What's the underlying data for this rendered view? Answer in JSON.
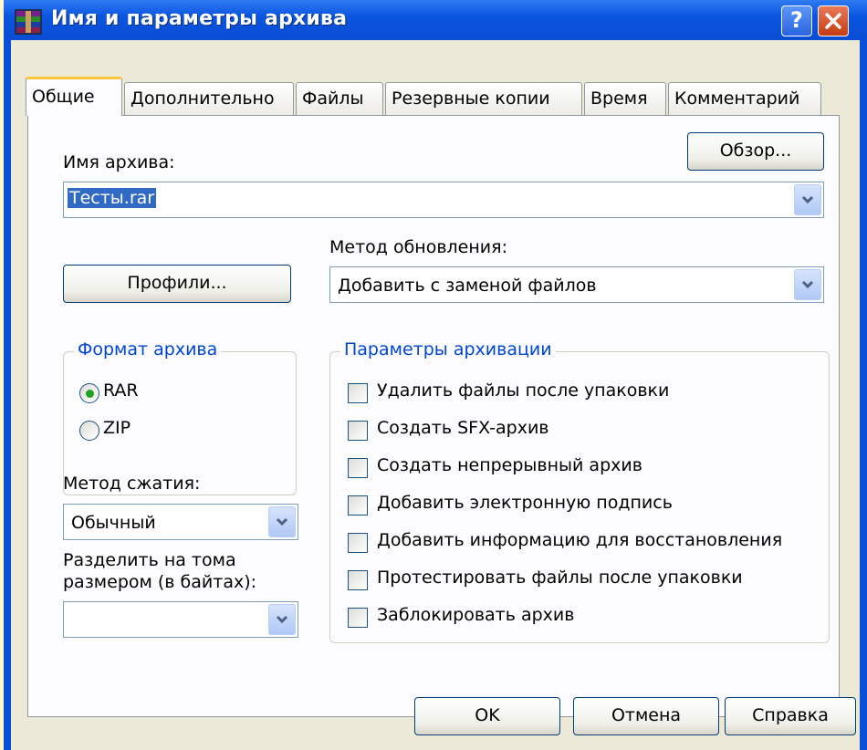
{
  "window": {
    "title": "Имя и параметры архива",
    "help_label": "?",
    "close_label": "X"
  },
  "tabs": [
    {
      "label": "Общие"
    },
    {
      "label": "Дополнительно"
    },
    {
      "label": "Файлы"
    },
    {
      "label": "Резервные копии"
    },
    {
      "label": "Время"
    },
    {
      "label": "Комментарий"
    }
  ],
  "archive_name": {
    "label": "Имя архива:",
    "value": "Тесты.rar",
    "browse_label": "Обзор..."
  },
  "profiles_label": "Профили...",
  "update_method": {
    "label": "Метод обновления:",
    "value": "Добавить с заменой файлов"
  },
  "archive_format": {
    "title": "Формат архива",
    "options": [
      "RAR",
      "ZIP"
    ],
    "selected": "RAR"
  },
  "compression": {
    "label": "Метод сжатия:",
    "value": "Обычный"
  },
  "split": {
    "label_line1": "Разделить на тома",
    "label_line2": "размером (в байтах):",
    "value": ""
  },
  "options": {
    "title": "Параметры архивации",
    "items": [
      {
        "label": "Удалить файлы после упаковки",
        "checked": false
      },
      {
        "label": "Создать SFX-архив",
        "checked": false
      },
      {
        "label": "Создать непрерывный архив",
        "checked": false
      },
      {
        "label": "Добавить электронную подпись",
        "checked": false
      },
      {
        "label": "Добавить информацию для восстановления",
        "checked": false
      },
      {
        "label": "Протестировать файлы после упаковки",
        "checked": false
      },
      {
        "label": "Заблокировать архив",
        "checked": false
      }
    ]
  },
  "buttons": {
    "ok": "OK",
    "cancel": "Отмена",
    "help": "Справка"
  },
  "colors": {
    "titlebar": "#0A4FD8",
    "dialog_bg": "#ECE9D8",
    "group_title": "#0046D5",
    "selection": "#316AC5",
    "active_tab_accent": "#FFC83C"
  }
}
